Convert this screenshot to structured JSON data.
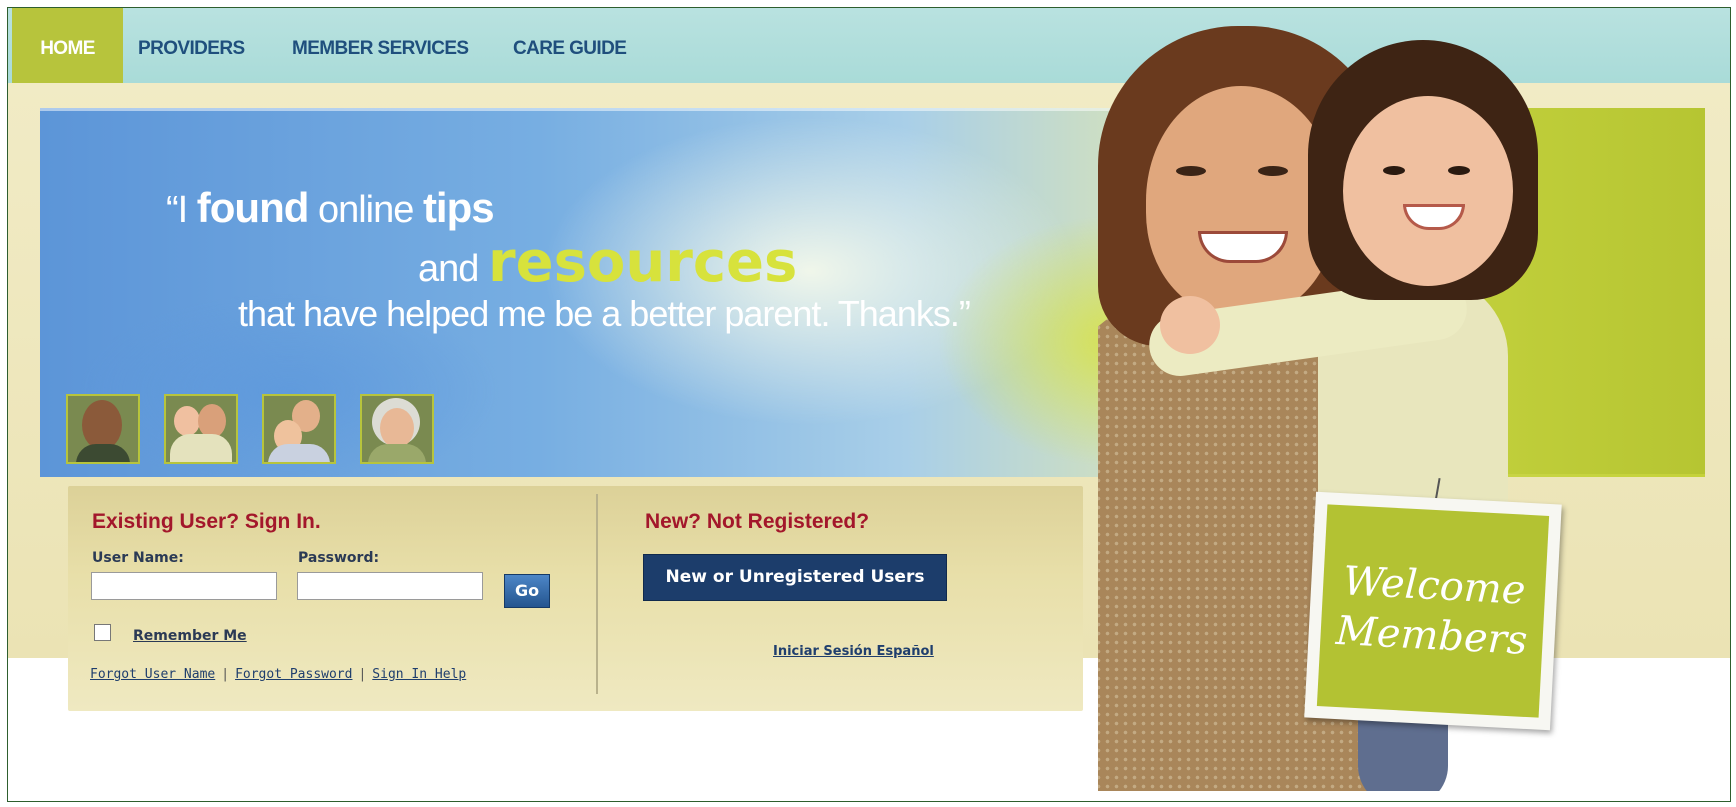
{
  "nav": {
    "home": "HOME",
    "providers": "PROVIDERS",
    "member_services": "MEMBER SERVICES",
    "care_guide": "CARE GUIDE"
  },
  "hero": {
    "quote_part1_open": "“I ",
    "quote_part1_found": "found",
    "quote_part1_mid": " online ",
    "quote_part1_tips": "tips",
    "quote_part2_and": "and ",
    "quote_part2_resources": "resources",
    "quote_part3": "that have helped me be a better parent.  Thanks.”"
  },
  "sign": {
    "line1": "Welcome",
    "line2": "Members"
  },
  "signin": {
    "title": "Existing User? Sign In.",
    "username_label": "User Name:",
    "password_label": "Password:",
    "username_value": "",
    "password_value": "",
    "go_label": "Go",
    "remember_label": "Remember Me",
    "forgot_username": "Forgot User Name",
    "forgot_password": "Forgot Password",
    "sign_in_help": "Sign In Help",
    "separator": "|"
  },
  "register": {
    "title": "New? Not Registered?",
    "button_label": "New or Unregistered Users",
    "spanish_link": "Iniciar Sesión Español"
  },
  "colors": {
    "nav_bg": "#b9e2e0",
    "accent_green": "#b7c43c",
    "title_red": "#a3172b",
    "button_navy": "#1c3d6b"
  }
}
